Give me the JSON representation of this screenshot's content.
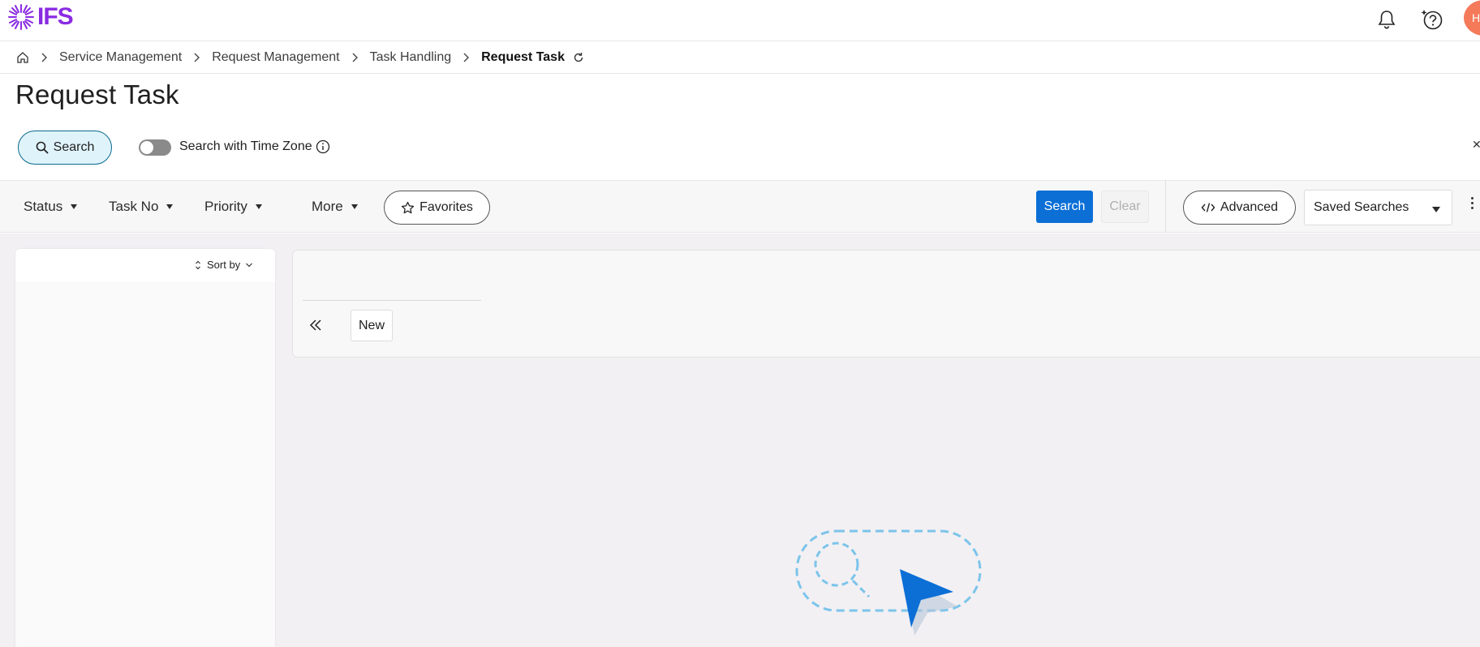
{
  "app": {
    "logo_text": "IFS",
    "avatar_initial": "H"
  },
  "icons": [
    "home-icon",
    "chevron-right-icon",
    "refresh-icon",
    "bell-icon",
    "ai-help-icon",
    "search-icon",
    "info-icon",
    "star-icon",
    "code-icon",
    "double-chevron-left-icon",
    "sort-icon",
    "chevron-down-icon",
    "kebab-icon"
  ],
  "breadcrumb": {
    "items": [
      "Service Management",
      "Request Management",
      "Task Handling"
    ],
    "current": "Request Task"
  },
  "page": {
    "title": "Request Task"
  },
  "search_options": {
    "search_chip": "Search",
    "timezone_toggle_label": "Search with Time Zone",
    "timezone_toggle_on": false
  },
  "filterbar": {
    "filters": [
      "Status",
      "Task No",
      "Priority",
      "More"
    ],
    "favorites": "Favorites",
    "search": "Search",
    "clear": "Clear",
    "advanced": "Advanced",
    "saved_searches": "Saved Searches"
  },
  "list_panel": {
    "sort_by": "Sort by"
  },
  "detail_panel": {
    "new_button": "New"
  },
  "colors": {
    "brand": "#8a2be2",
    "primary": "#0b6fd6",
    "chip_bg": "#dff3fa",
    "avatar": "#f47a5a"
  }
}
